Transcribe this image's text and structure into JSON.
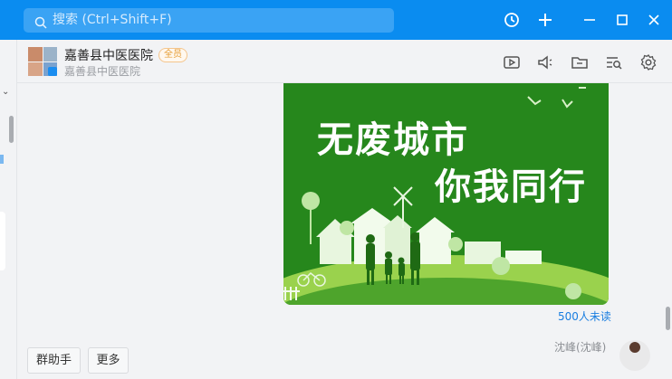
{
  "search": {
    "placeholder": "搜索 (Ctrl+Shift+F)"
  },
  "titlebar_icons": [
    "history-icon",
    "plus-icon",
    "minimize-icon",
    "maximize-icon",
    "close-icon"
  ],
  "chat": {
    "title": "嘉善县中医医院",
    "badge": "全员",
    "subtitle": "嘉善县中医医院",
    "toolbar_icons": [
      "live-icon",
      "announcement-icon",
      "folder-icon",
      "search-history-icon",
      "settings-icon"
    ]
  },
  "poster": {
    "line1": "无废城市",
    "line2": "你我同行"
  },
  "message": {
    "unread": "500人未读",
    "next_sender_partial": "沈峰(沈峰)"
  },
  "bottom": {
    "assistant": "群助手",
    "more": "更多"
  },
  "colors": {
    "titlebar": "#0a8cf0",
    "link": "#1a7ee0",
    "poster_green": "#26871c"
  }
}
